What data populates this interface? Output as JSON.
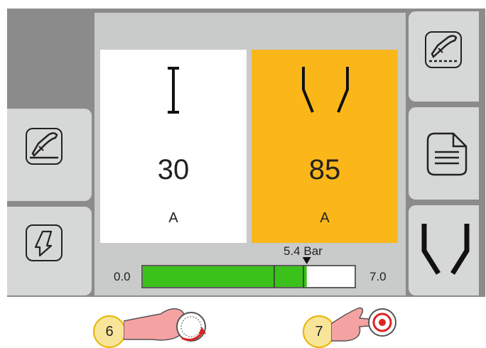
{
  "colors": {
    "frame": "#8a8b8a",
    "content_bg": "#c9cbca",
    "button_bg": "#d6d8d7",
    "panel_left_bg": "#ffffff",
    "panel_right_bg": "#fbb719",
    "gauge_fill": "#3ac11a"
  },
  "left_panel": {
    "icon": "current-i-icon",
    "value": "30",
    "unit": "A"
  },
  "right_panel": {
    "icon": "taper-nozzle-icon",
    "value": "85",
    "unit": "A"
  },
  "gauge": {
    "min_label": "0.0",
    "max_label": "7.0",
    "current_label": "5.4 Bar",
    "min": 0.0,
    "max": 7.0,
    "value": 5.4
  },
  "left_buttons": [
    "torch-gouge-icon",
    "torch-down-arrow-icon"
  ],
  "right_buttons": [
    "torch-cut-dashed-icon",
    "document-icon",
    "nozzle-icon"
  ],
  "callouts": [
    {
      "number": "6",
      "gesture": "hand-rotate-knob-icon"
    },
    {
      "number": "7",
      "gesture": "hand-press-button-icon"
    }
  ]
}
